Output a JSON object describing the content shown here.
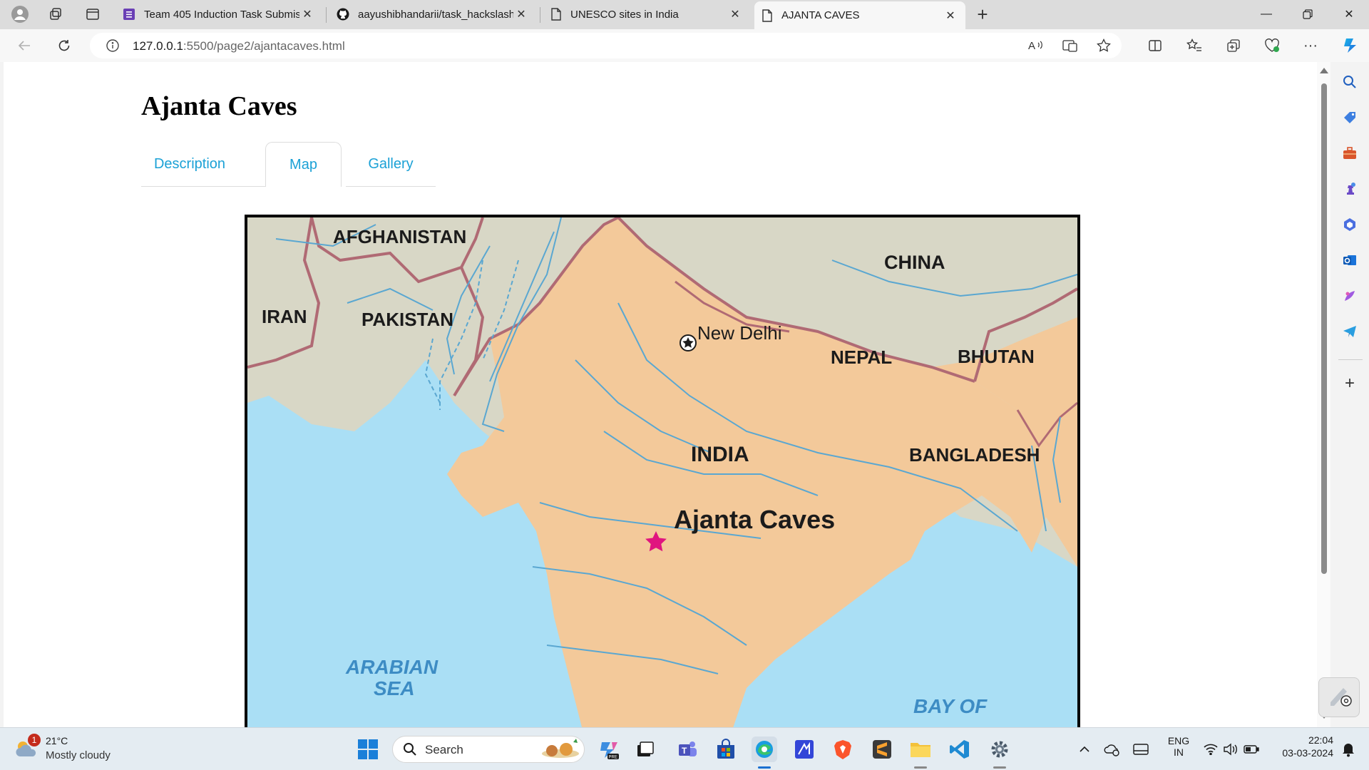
{
  "browser": {
    "tabs": [
      {
        "title": "Team 405 Induction Task Submis",
        "icon": "forms-icon",
        "active": false
      },
      {
        "title": "aayushibhandarii/task_hackslash",
        "icon": "github-icon",
        "active": false
      },
      {
        "title": "UNESCO sites in India",
        "icon": "page-icon",
        "active": false
      },
      {
        "title": "AJANTA CAVES",
        "icon": "page-icon",
        "active": true
      }
    ],
    "address": {
      "host": "127.0.0.1",
      "path": ":5500/page2/ajantacaves.html"
    }
  },
  "page": {
    "title": "Ajanta Caves",
    "tabs": [
      {
        "label": "Description",
        "active": false
      },
      {
        "label": "Map",
        "active": true
      },
      {
        "label": "Gallery",
        "active": false
      }
    ],
    "map": {
      "labels": {
        "afghanistan": "AFGHANISTAN",
        "china": "CHINA",
        "iran": "IRAN",
        "pakistan": "PAKISTAN",
        "new_delhi": "New Delhi",
        "nepal": "NEPAL",
        "bhutan": "BHUTAN",
        "india": "INDIA",
        "bangladesh": "BANGLADESH",
        "ajanta": "Ajanta Caves",
        "arabian1": "ARABIAN",
        "arabian2": "SEA",
        "bay": "BAY OF"
      },
      "colors": {
        "land_india": "#f3c99a",
        "land_other": "#d8d7c6",
        "sea": "#aadff5",
        "border": "#b06a74",
        "river": "#5aa7d1",
        "star": "#e0157f"
      }
    }
  },
  "taskbar": {
    "weather": {
      "temp": "21°C",
      "condition": "Mostly cloudy",
      "badge": "1"
    },
    "search_placeholder": "Search",
    "lang": {
      "line1": "ENG",
      "line2": "IN"
    },
    "clock": {
      "time": "22:04",
      "date": "03-03-2024"
    }
  }
}
